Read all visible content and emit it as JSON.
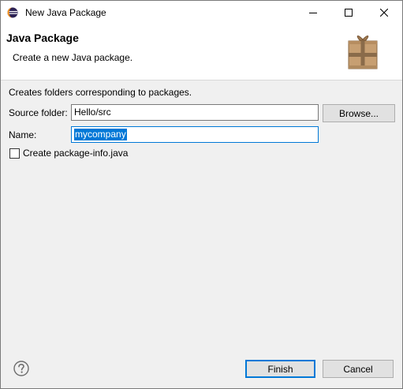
{
  "window": {
    "title": "New Java Package"
  },
  "titlebar": {
    "icons": [
      "eclipse-icon",
      "minimize-icon",
      "maximize-icon",
      "close-icon"
    ]
  },
  "banner": {
    "title": "Java Package",
    "description": "Create a new Java package.",
    "icon": "package-icon"
  },
  "form": {
    "info": "Creates folders corresponding to packages.",
    "source_folder": {
      "label": "Source folder:",
      "value": "Hello/src",
      "browse_label": "Browse..."
    },
    "name": {
      "label": "Name:",
      "value": "mycompany"
    },
    "package_info": {
      "label": "Create package-info.java",
      "checked": false
    }
  },
  "footer": {
    "help_icon": "help-icon",
    "finish_label": "Finish",
    "cancel_label": "Cancel"
  },
  "colors": {
    "accent": "#0078d7",
    "window_bg": "#f0f0f0",
    "button_bg": "#e1e1e1"
  }
}
